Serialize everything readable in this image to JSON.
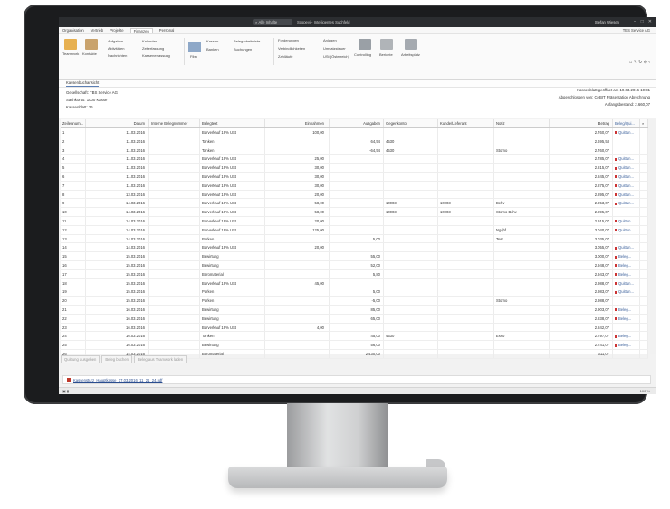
{
  "titlebar": {
    "search_placeholder": "Alle Inhalte",
    "title": "Scopevi - Intelligentes Suchfeld",
    "user": "Stefan Wiesen"
  },
  "menubar": {
    "items": [
      "Organisation",
      "Vertrieb",
      "Projekte",
      "Finanzen",
      "Personal"
    ],
    "active_index": 3,
    "company": "TBS Service AG"
  },
  "ribbon": {
    "teamwork": "Teamwork",
    "kontakte": "Kontakte",
    "aufgaben": "Aufgaben",
    "aktivitaeten": "Aktivitäten",
    "nachrichten": "Nachrichten",
    "kalender": "Kalender",
    "zeiterfassung": "Zeiterfassung",
    "kassenerfassung": "Kassenerfassung",
    "fibu": "Fibu",
    "kassen": "Kassen",
    "banken": "Banken",
    "belegarbeitsliste": "Belegarbeitsliste",
    "buchungen": "Buchungen",
    "forderungen": "Forderungen",
    "verbindlichkeiten": "Verbindlichkeiten",
    "zahlläufe": "Zahlläufe",
    "anlagen": "Anlagen",
    "umsatzsteuer": "Umsatzsteuer",
    "ust": "USt (Österreich)",
    "controlling": "Controlling",
    "berichte": "Berichte",
    "arbeitsplatz": "Arbeitsplatz"
  },
  "subheader": {
    "tab": "Kassenbuchansicht"
  },
  "meta": {
    "gesellschaft": "Gesellschaft: TBS Service AG",
    "sachkonto": "Sachkonto: 1000 Kasse",
    "kassenblatt": "Kassenblatt: 26",
    "geoeffnet": "Kassenblatt geöffnet am 10.03.2016 10:31",
    "abgeschlossen": "Abgeschlossen von: CeBIT Präsentation Abrechnung",
    "anfangsbestand": "Anfangsbestand: 2.660,07"
  },
  "table": {
    "headers": [
      "Zeilennum...",
      "Datum",
      "Interne Belegnummer",
      "Belegtext",
      "Einnahmen",
      "Ausgaben",
      "Gegenkonto",
      "Kunde/Lieferant",
      "Notiz",
      "Betrag",
      "Beleg/Qui..."
    ],
    "rows": [
      {
        "nr": "1",
        "datum": "11.03.2016",
        "beleg": "Barverkauf 19% USt",
        "ein": "100,00",
        "aus": "",
        "geg": "",
        "kun": "",
        "notiz": "",
        "betrag": "2.760,07",
        "bq": "Quittun..."
      },
      {
        "nr": "2",
        "datum": "11.03.2016",
        "beleg": "Tanken",
        "ein": "",
        "aus": "64,54",
        "geg": "4530",
        "kun": "",
        "notiz": "",
        "betrag": "2.695,53",
        "bq": ""
      },
      {
        "nr": "3",
        "datum": "11.03.2016",
        "beleg": "Tanken",
        "ein": "",
        "aus": "-64,54",
        "geg": "4530",
        "kun": "",
        "notiz": "Storno",
        "betrag": "2.760,07",
        "bq": ""
      },
      {
        "nr": "4",
        "datum": "11.03.2016",
        "beleg": "Barverkauf 19% USt",
        "ein": "25,00",
        "aus": "",
        "geg": "",
        "kun": "",
        "notiz": "",
        "betrag": "2.785,07",
        "bq": "Quittun..."
      },
      {
        "nr": "5",
        "datum": "11.03.2016",
        "beleg": "Barverkauf 19% USt",
        "ein": "30,00",
        "aus": "",
        "geg": "",
        "kun": "",
        "notiz": "",
        "betrag": "2.815,07",
        "bq": "Quittun..."
      },
      {
        "nr": "6",
        "datum": "11.03.2016",
        "beleg": "Barverkauf 19% USt",
        "ein": "30,00",
        "aus": "",
        "geg": "",
        "kun": "",
        "notiz": "",
        "betrag": "2.845,07",
        "bq": "Quittun..."
      },
      {
        "nr": "7",
        "datum": "11.03.2016",
        "beleg": "Barverkauf 19% USt",
        "ein": "30,00",
        "aus": "",
        "geg": "",
        "kun": "",
        "notiz": "",
        "betrag": "2.875,07",
        "bq": "Quittun..."
      },
      {
        "nr": "8",
        "datum": "13.03.2016",
        "beleg": "Barverkauf 19% USt",
        "ein": "20,00",
        "aus": "",
        "geg": "",
        "kun": "",
        "notiz": "",
        "betrag": "2.895,07",
        "bq": "Quittun..."
      },
      {
        "nr": "9",
        "datum": "14.03.2016",
        "beleg": "Barverkauf 19% USt",
        "ein": "58,00",
        "aus": "",
        "geg": "10003",
        "kun": "10003",
        "notiz": "Bchv",
        "betrag": "2.953,07",
        "bq": "Quittun..."
      },
      {
        "nr": "10",
        "datum": "14.03.2016",
        "beleg": "Barverkauf 19% USt",
        "ein": "-58,00",
        "aus": "",
        "geg": "10003",
        "kun": "10003",
        "notiz": "Storno Bchv",
        "betrag": "2.895,07",
        "bq": ""
      },
      {
        "nr": "11",
        "datum": "14.03.2016",
        "beleg": "Barverkauf 19% USt",
        "ein": "20,00",
        "aus": "",
        "geg": "",
        "kun": "",
        "notiz": "",
        "betrag": "2.915,07",
        "bq": "Quittun..."
      },
      {
        "nr": "12",
        "datum": "14.03.2016",
        "beleg": "Barverkauf 19% USt",
        "ein": "125,00",
        "aus": "",
        "geg": "",
        "kun": "",
        "notiz": "Ng/jhf",
        "betrag": "3.040,07",
        "bq": "Quittun..."
      },
      {
        "nr": "13",
        "datum": "14.03.2016",
        "beleg": "Parken",
        "ein": "",
        "aus": "5,00",
        "geg": "",
        "kun": "",
        "notiz": "Test",
        "betrag": "3.035,07",
        "bq": ""
      },
      {
        "nr": "14",
        "datum": "14.03.2016",
        "beleg": "Barverkauf 19% USt",
        "ein": "20,00",
        "aus": "",
        "geg": "",
        "kun": "",
        "notiz": "",
        "betrag": "3.055,07",
        "bq": "Quittun..."
      },
      {
        "nr": "15",
        "datum": "15.03.2016",
        "beleg": "Bewirtung",
        "ein": "",
        "aus": "55,00",
        "geg": "",
        "kun": "",
        "notiz": "",
        "betrag": "3.000,07",
        "bq": "Beleg..."
      },
      {
        "nr": "16",
        "datum": "15.03.2016",
        "beleg": "Bewirtung",
        "ein": "",
        "aus": "52,00",
        "geg": "",
        "kun": "",
        "notiz": "",
        "betrag": "2.948,07",
        "bq": "Beleg..."
      },
      {
        "nr": "17",
        "datum": "15.03.2016",
        "beleg": "Büromaterial",
        "ein": "",
        "aus": "5,80",
        "geg": "",
        "kun": "",
        "notiz": "",
        "betrag": "2.943,07",
        "bq": "Beleg..."
      },
      {
        "nr": "18",
        "datum": "15.03.2016",
        "beleg": "Barverkauf 19% USt",
        "ein": "45,00",
        "aus": "",
        "geg": "",
        "kun": "",
        "notiz": "",
        "betrag": "2.988,07",
        "bq": "Quittun..."
      },
      {
        "nr": "19",
        "datum": "15.03.2016",
        "beleg": "Parken",
        "ein": "",
        "aus": "5,00",
        "geg": "",
        "kun": "",
        "notiz": "",
        "betrag": "2.983,07",
        "bq": "Quittun..."
      },
      {
        "nr": "20",
        "datum": "15.03.2016",
        "beleg": "Parken",
        "ein": "",
        "aus": "-5,00",
        "geg": "",
        "kun": "",
        "notiz": "Storno",
        "betrag": "2.988,07",
        "bq": ""
      },
      {
        "nr": "21",
        "datum": "16.03.2016",
        "beleg": "Bewirtung",
        "ein": "",
        "aus": "85,00",
        "geg": "",
        "kun": "",
        "notiz": "",
        "betrag": "2.903,07",
        "bq": "Beleg..."
      },
      {
        "nr": "22",
        "datum": "16.03.2016",
        "beleg": "Bewirtung",
        "ein": "",
        "aus": "65,00",
        "geg": "",
        "kun": "",
        "notiz": "",
        "betrag": "2.838,07",
        "bq": "Beleg..."
      },
      {
        "nr": "23",
        "datum": "16.03.2016",
        "beleg": "Barverkauf 19% USt",
        "ein": "4,00",
        "aus": "",
        "geg": "",
        "kun": "",
        "notiz": "",
        "betrag": "2.842,07",
        "bq": ""
      },
      {
        "nr": "24",
        "datum": "16.03.2016",
        "beleg": "Tanken",
        "ein": "",
        "aus": "45,00",
        "geg": "4530",
        "kun": "",
        "notiz": "Esso",
        "betrag": "2.797,07",
        "bq": "Beleg..."
      },
      {
        "nr": "25",
        "datum": "16.03.2016",
        "beleg": "Bewirtung",
        "ein": "",
        "aus": "56,00",
        "geg": "",
        "kun": "",
        "notiz": "",
        "betrag": "2.741,07",
        "bq": "Beleg..."
      },
      {
        "nr": "26",
        "datum": "14.03.2016",
        "beleg": "Büromaterial",
        "ein": "",
        "aus": "2.430,00",
        "geg": "",
        "kun": "",
        "notiz": "",
        "betrag": "311,07",
        "bq": ""
      }
    ]
  },
  "buttons": {
    "quittung": "Quittung ausgeben",
    "beleg_buchen": "Beleg buchen",
    "teamwork": "Beleg aus Teamwork laden"
  },
  "attachment": {
    "file": "Kassensturz_Hauptkasse_17.03.2016_11_21_24.pdf"
  },
  "statusbar": {
    "right": "100 %"
  }
}
